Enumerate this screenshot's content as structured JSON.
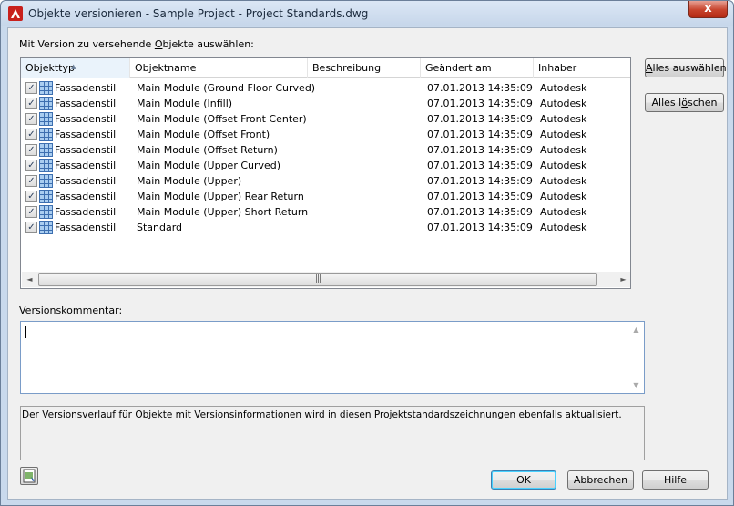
{
  "window": {
    "title": "Objekte versionieren - Sample Project - Project Standards.dwg",
    "close_label": "x"
  },
  "labels": {
    "select_pre": "Mit Version zu versehende ",
    "select_key": "O",
    "select_post": "bjekte auswählen:",
    "comment_key": "V",
    "comment_rest": "ersionskommentar:"
  },
  "table": {
    "headers": [
      "Objekttyp",
      "Objektname",
      "Beschreibung",
      "Geändert am",
      "Inhaber"
    ],
    "rows": [
      {
        "checked": true,
        "type": "Fassadenstil",
        "name": "Main Module (Ground Floor Curved)",
        "desc": "",
        "date": "07.01.2013 14:35:09",
        "owner": "Autodesk"
      },
      {
        "checked": true,
        "type": "Fassadenstil",
        "name": "Main Module (Infill)",
        "desc": "",
        "date": "07.01.2013 14:35:09",
        "owner": "Autodesk"
      },
      {
        "checked": true,
        "type": "Fassadenstil",
        "name": "Main Module (Offset Front Center)",
        "desc": "",
        "date": "07.01.2013 14:35:09",
        "owner": "Autodesk"
      },
      {
        "checked": true,
        "type": "Fassadenstil",
        "name": "Main Module (Offset Front)",
        "desc": "",
        "date": "07.01.2013 14:35:09",
        "owner": "Autodesk"
      },
      {
        "checked": true,
        "type": "Fassadenstil",
        "name": "Main Module (Offset Return)",
        "desc": "",
        "date": "07.01.2013 14:35:09",
        "owner": "Autodesk"
      },
      {
        "checked": true,
        "type": "Fassadenstil",
        "name": "Main Module (Upper Curved)",
        "desc": "",
        "date": "07.01.2013 14:35:09",
        "owner": "Autodesk"
      },
      {
        "checked": true,
        "type": "Fassadenstil",
        "name": "Main Module (Upper)",
        "desc": "",
        "date": "07.01.2013 14:35:09",
        "owner": "Autodesk"
      },
      {
        "checked": true,
        "type": "Fassadenstil",
        "name": "Main Module (Upper) Rear Return",
        "desc": "",
        "date": "07.01.2013 14:35:09",
        "owner": "Autodesk"
      },
      {
        "checked": true,
        "type": "Fassadenstil",
        "name": "Main Module (Upper) Short Return",
        "desc": "",
        "date": "07.01.2013 14:35:09",
        "owner": "Autodesk"
      },
      {
        "checked": true,
        "type": "Fassadenstil",
        "name": "Standard",
        "desc": "",
        "date": "07.01.2013 14:35:09",
        "owner": "Autodesk"
      }
    ]
  },
  "buttons": {
    "select_all_key": "A",
    "select_all_rest": "lles auswählen",
    "clear_all_pre": "Alles l",
    "clear_all_key": "ö",
    "clear_all_post": "schen",
    "ok": "OK",
    "cancel": "Abbrechen",
    "help": "Hilfe"
  },
  "comment": {
    "value": ""
  },
  "info_text": "Der Versionsverlauf für Objekte mit Versionsinformationen wird in diesen Projektstandardszeichnungen ebenfalls aktualisiert.",
  "icons": {
    "app": "autocad-icon",
    "row": "curtain-wall-style-icon",
    "sort": "sort-ascending-icon",
    "help_tool": "preview-icon"
  }
}
